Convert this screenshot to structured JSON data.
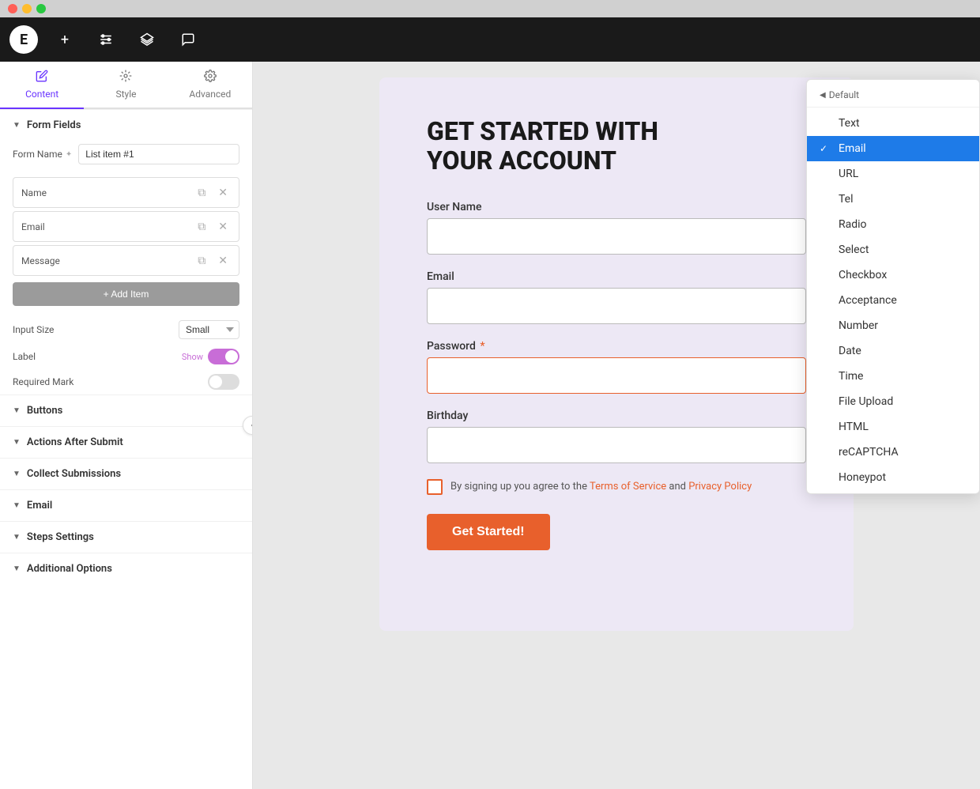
{
  "titlebar": {
    "traffic_lights": [
      "red",
      "yellow",
      "green"
    ]
  },
  "toolbar": {
    "logo": "E",
    "buttons": [
      "+",
      "≡",
      "⊕",
      "💬"
    ]
  },
  "left_panel": {
    "tabs": [
      {
        "label": "Content",
        "icon": "✏️",
        "active": true
      },
      {
        "label": "Style",
        "icon": "🎨",
        "active": false
      },
      {
        "label": "Advanced",
        "icon": "⚙️",
        "active": false
      }
    ],
    "form_fields_section": {
      "title": "Form Fields",
      "form_name_label": "Form Name",
      "form_name_value": "List item #1",
      "fields": [
        {
          "label": "Name"
        },
        {
          "label": "Email"
        },
        {
          "label": "Message"
        }
      ],
      "add_item_label": "+ Add Item",
      "input_size_label": "Input Size",
      "input_size_value": "Small",
      "label_label": "Label",
      "label_toggle": true,
      "label_toggle_text": "Show",
      "required_mark_label": "Required Mark",
      "required_mark_toggle": false
    },
    "sections": [
      {
        "label": "Buttons"
      },
      {
        "label": "Actions After Submit"
      },
      {
        "label": "Collect Submissions"
      },
      {
        "label": "Email"
      },
      {
        "label": "Steps Settings"
      },
      {
        "label": "Additional Options"
      }
    ]
  },
  "form": {
    "title_line1": "GET STARTED WITH",
    "title_line2": "YOUR ACCOUNT",
    "fields": [
      {
        "label": "User Name",
        "required": false,
        "type": "text",
        "error": false
      },
      {
        "label": "Email",
        "required": false,
        "type": "email",
        "error": false
      },
      {
        "label": "Password",
        "required": true,
        "type": "password",
        "error": true
      },
      {
        "label": "Birthday",
        "required": false,
        "type": "text",
        "error": false
      }
    ],
    "checkbox_text_before": "By signing up you agree to the ",
    "checkbox_link1": "Terms of Service",
    "checkbox_text_mid": " and ",
    "checkbox_link2": "Privacy Policy",
    "submit_label": "Get Started!"
  },
  "dropdown": {
    "header": "Default",
    "items": [
      {
        "label": "Text",
        "selected": false
      },
      {
        "label": "Email",
        "selected": true
      },
      {
        "label": "URL",
        "selected": false
      },
      {
        "label": "Tel",
        "selected": false
      },
      {
        "label": "Radio",
        "selected": false
      },
      {
        "label": "Select",
        "selected": false
      },
      {
        "label": "Checkbox",
        "selected": false
      },
      {
        "label": "Acceptance",
        "selected": false
      },
      {
        "label": "Number",
        "selected": false
      },
      {
        "label": "Date",
        "selected": false
      },
      {
        "label": "Time",
        "selected": false
      },
      {
        "label": "File Upload",
        "selected": false
      },
      {
        "label": "HTML",
        "selected": false
      },
      {
        "label": "reCAPTCHA",
        "selected": false
      },
      {
        "label": "Honeypot",
        "selected": false
      }
    ]
  }
}
